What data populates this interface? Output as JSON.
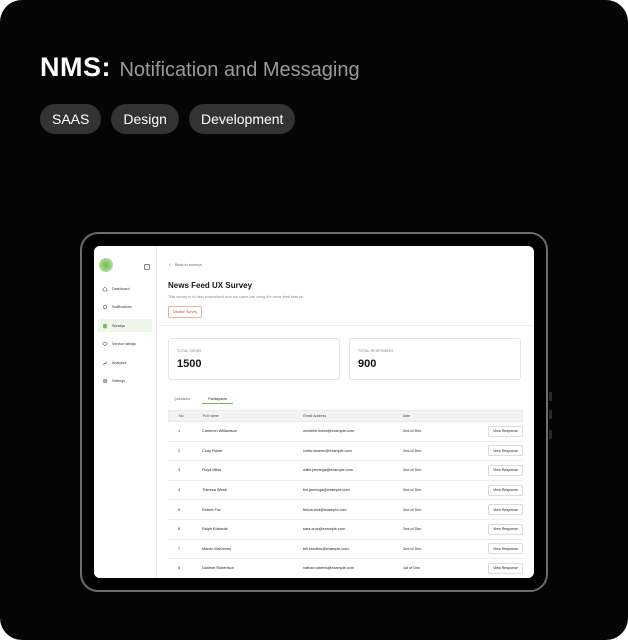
{
  "header": {
    "brand": "NMS:",
    "tagline": "Notification and Messaging",
    "tags": [
      "SAAS",
      "Design",
      "Development"
    ]
  },
  "sidebar": {
    "items": [
      {
        "label": "Dashboard",
        "icon": "home-icon",
        "active": false
      },
      {
        "label": "Notifications",
        "icon": "bell-icon",
        "active": false
      },
      {
        "label": "Surveys",
        "icon": "clipboard-icon",
        "active": true
      },
      {
        "label": "Service ratings",
        "icon": "heart-icon",
        "active": false
      },
      {
        "label": "Analytics",
        "icon": "chart-icon",
        "active": false
      },
      {
        "label": "Settings",
        "icon": "gear-icon",
        "active": false
      }
    ]
  },
  "page": {
    "back_label": "Back to surveys",
    "title": "News Feed UX Survey",
    "subtitle": "This survey is to help understand how our users are using the news feed feature.",
    "disable_label": "Disable Survey"
  },
  "stats": {
    "views_label": "TOTAL VIEWS",
    "views_value": "1500",
    "responses_label": "TOTAL RESPONSES",
    "responses_value": "900"
  },
  "tabs": [
    "Questions",
    "Participants"
  ],
  "table": {
    "headers": [
      "No",
      "Full name",
      "Email Address",
      "Date"
    ],
    "action_label": "View Response",
    "rows": [
      {
        "no": "1",
        "name": "Cameron Williamson",
        "email": "michelle.rivera@example.com",
        "date": "2nd of Dec"
      },
      {
        "no": "2",
        "name": "Cody Fisher",
        "email": "curtis.weaver@example.com",
        "date": "2nd of Dec"
      },
      {
        "no": "3",
        "name": "Floyd Miles",
        "email": "willie.jennings@example.com",
        "date": "2nd of Dec"
      },
      {
        "no": "4",
        "name": "Theresa Webb",
        "email": "tim.jennings@example.com",
        "date": "2nd of Dec"
      },
      {
        "no": "5",
        "name": "Robert Fox",
        "email": "felicia.reid@example.com",
        "date": "2nd of Dec"
      },
      {
        "no": "6",
        "name": "Ralph Edwards",
        "email": "sara.cruz@example.com",
        "date": "2nd of Dec"
      },
      {
        "no": "7",
        "name": "Marvin McKinney",
        "email": "bill.sanders@example.com",
        "date": "2nd of Dec"
      },
      {
        "no": "8",
        "name": "Darlene Robertson",
        "email": "nathan.roberts@example.com",
        "date": "1st of Dec"
      }
    ]
  },
  "colors": {
    "accent": "#6fbf4a",
    "danger": "#d34a3e",
    "background": "#050505",
    "tag_bg": "#333333"
  }
}
